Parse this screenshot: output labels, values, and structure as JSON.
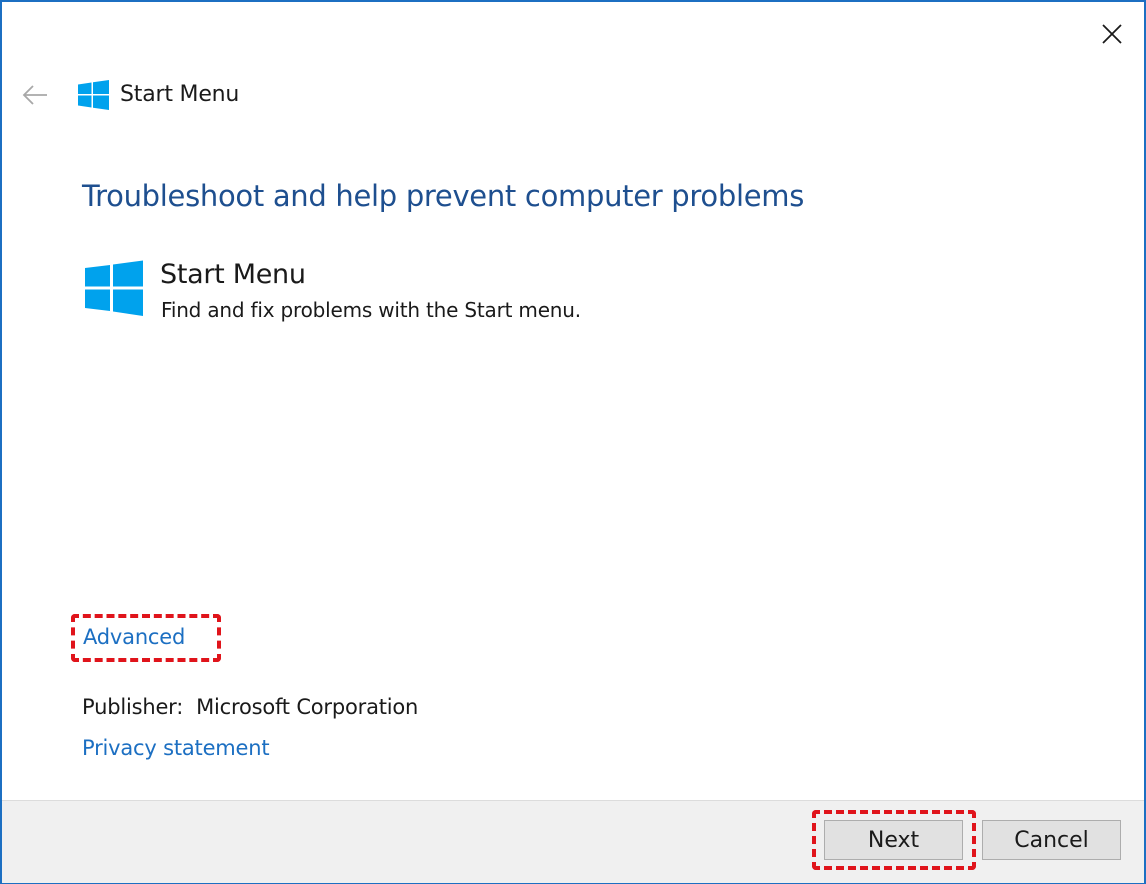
{
  "window": {
    "title": "Start Menu",
    "close_icon": "close-icon",
    "back_icon": "back-arrow-icon",
    "logo_icon": "windows-logo-icon",
    "accent_color": "#1c6fc2",
    "logo_color": "#00a2ed"
  },
  "main": {
    "heading": "Troubleshoot and help prevent computer problems",
    "troubleshooter": {
      "title": "Start Menu",
      "description": "Find and fix problems with the Start menu.",
      "icon": "windows-logo-icon"
    },
    "advanced_link": "Advanced",
    "publisher_label": "Publisher:",
    "publisher_value": "Microsoft Corporation",
    "privacy_link": "Privacy statement"
  },
  "footer": {
    "next_label": "Next",
    "cancel_label": "Cancel"
  },
  "annotations": {
    "highlight_color": "#e0141b"
  }
}
